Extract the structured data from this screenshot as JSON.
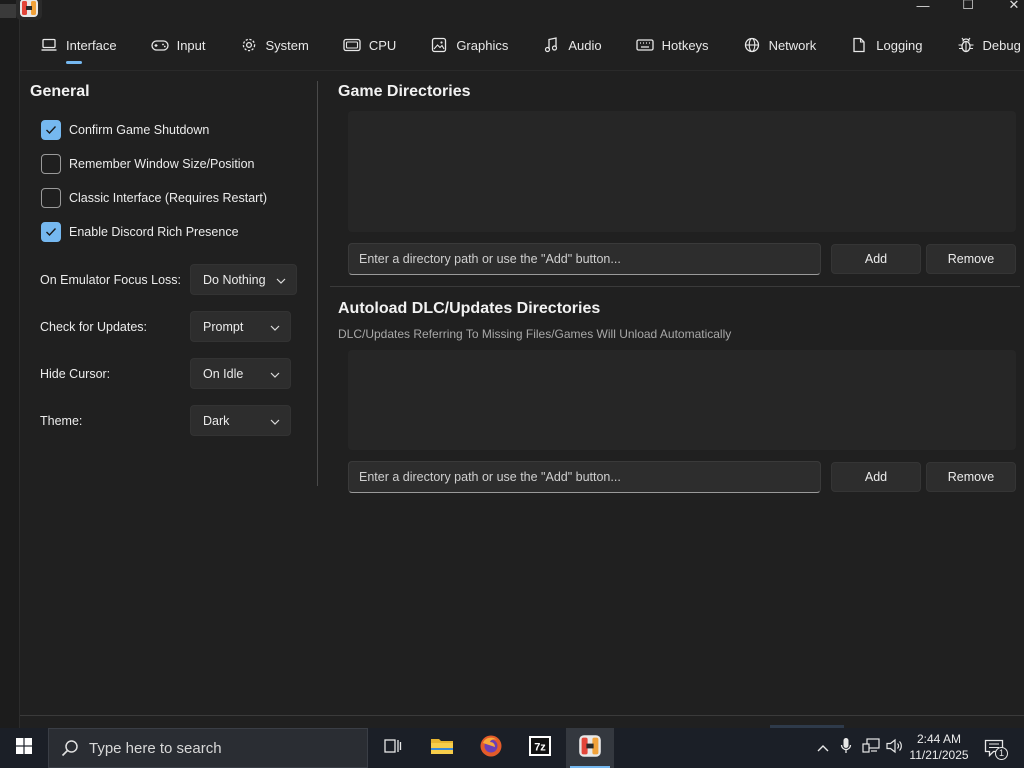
{
  "window": {
    "minimize_glyph": "—",
    "maximize_glyph": "☐",
    "close_glyph": "✕"
  },
  "tabs": [
    {
      "label": "Interface",
      "icon": "monitor-icon",
      "active": true
    },
    {
      "label": "Input",
      "icon": "gamepad-icon",
      "active": false
    },
    {
      "label": "System",
      "icon": "gear-icon",
      "active": false
    },
    {
      "label": "CPU",
      "icon": "cpu-icon",
      "active": false
    },
    {
      "label": "Graphics",
      "icon": "image-icon",
      "active": false
    },
    {
      "label": "Audio",
      "icon": "music-note-icon",
      "active": false
    },
    {
      "label": "Hotkeys",
      "icon": "keyboard-icon",
      "active": false
    },
    {
      "label": "Network",
      "icon": "globe-icon",
      "active": false
    },
    {
      "label": "Logging",
      "icon": "document-icon",
      "active": false
    },
    {
      "label": "Debug",
      "icon": "bug-icon",
      "active": false
    }
  ],
  "general": {
    "title": "General",
    "checkboxes": [
      {
        "label": "Confirm Game Shutdown",
        "checked": true
      },
      {
        "label": "Remember Window Size/Position",
        "checked": false
      },
      {
        "label": "Classic Interface (Requires Restart)",
        "checked": false
      },
      {
        "label": "Enable Discord Rich Presence",
        "checked": true
      }
    ],
    "settings": [
      {
        "label": "On Emulator Focus Loss:",
        "value": "Do Nothing"
      },
      {
        "label": "Check for Updates:",
        "value": "Prompt"
      },
      {
        "label": "Hide Cursor:",
        "value": "On Idle"
      },
      {
        "label": "Theme:",
        "value": "Dark"
      }
    ]
  },
  "game_dirs": {
    "title": "Game Directories",
    "placeholder": "Enter a directory path or use the \"Add\" button...",
    "add_label": "Add",
    "remove_label": "Remove"
  },
  "autoload_dirs": {
    "title": "Autoload DLC/Updates Directories",
    "subtitle": "DLC/Updates Referring To Missing Files/Games Will Unload Automatically",
    "placeholder": "Enter a directory path or use the \"Add\" button...",
    "add_label": "Add",
    "remove_label": "Remove"
  },
  "taskbar": {
    "search_placeholder": "Type here to search",
    "time": "2:44 AM",
    "date": "11/21/2025",
    "notification_count": "1"
  },
  "colors": {
    "accent": "#75b8f0",
    "background": "#202020",
    "control": "#2d2d2d"
  }
}
